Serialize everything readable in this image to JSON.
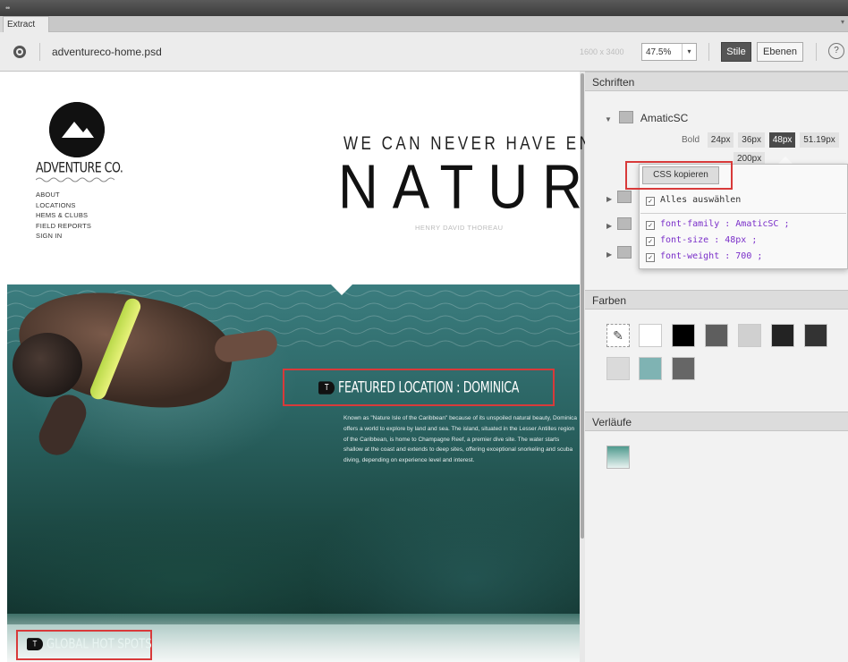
{
  "window": {
    "tab_label": "Extract",
    "menu_glyph": "▾"
  },
  "toolbar": {
    "filename": "adventureco-home.psd",
    "dimensions": "1600 x 3400",
    "zoom": "47.5%",
    "zoom_arrow": "▾",
    "stile_label": "Stile",
    "ebenen_label": "Ebenen",
    "help_glyph": "?"
  },
  "canvas": {
    "brand": "ADVENTURE CO.",
    "nav": [
      "ABOUT",
      "LOCATIONS",
      "HEMS & CLUBS",
      "FIELD REPORTS",
      "SIGN IN"
    ],
    "quote_line": "WE CAN NEVER HAVE ENOUGH OF",
    "quote_big": "NATURE",
    "quote_author": "HENRY DAVID THOREAU",
    "featured_title": "FEATURED LOCATION : DOMINICA",
    "featured_body": "Known as \"Nature Isle of the Caribbean\" because of its unspoiled natural beauty, Dominica offers a world to explore by land and sea. The island, situated in the Lesser Antilles region of the Caribbean, is home to Champagne Reef, a premier dive site. The water starts shallow at the coast and extends to deep sites, offering exceptional snorkeling and scuba diving, depending on experience level and interest.",
    "global_title": "GLOBAL HOT SPOTS",
    "badge": "T"
  },
  "panel": {
    "fonts_heading": "Schriften",
    "font_name": "AmaticSC",
    "weight_label": "Bold",
    "sizes": [
      "24px",
      "36px",
      "48px",
      "51.19px"
    ],
    "size_extra": "200px",
    "active_size": "48px",
    "copy_css": "CSS kopieren",
    "select_all": "Alles auswählen",
    "css_lines": [
      "font-family : AmaticSC ;",
      "font-size : 48px ;",
      "font-weight : 700 ;"
    ],
    "colors_heading": "Farben",
    "colors": [
      "#ffffff",
      "#000000",
      "#5e5e5e",
      "#d0d0d0",
      "#232323",
      "#333333",
      "#dadada",
      "#7fb3b3",
      "#666666"
    ],
    "gradients_heading": "Verläufe",
    "gradient_colors": [
      "#4f9a8e",
      "#e8f2f0"
    ]
  }
}
